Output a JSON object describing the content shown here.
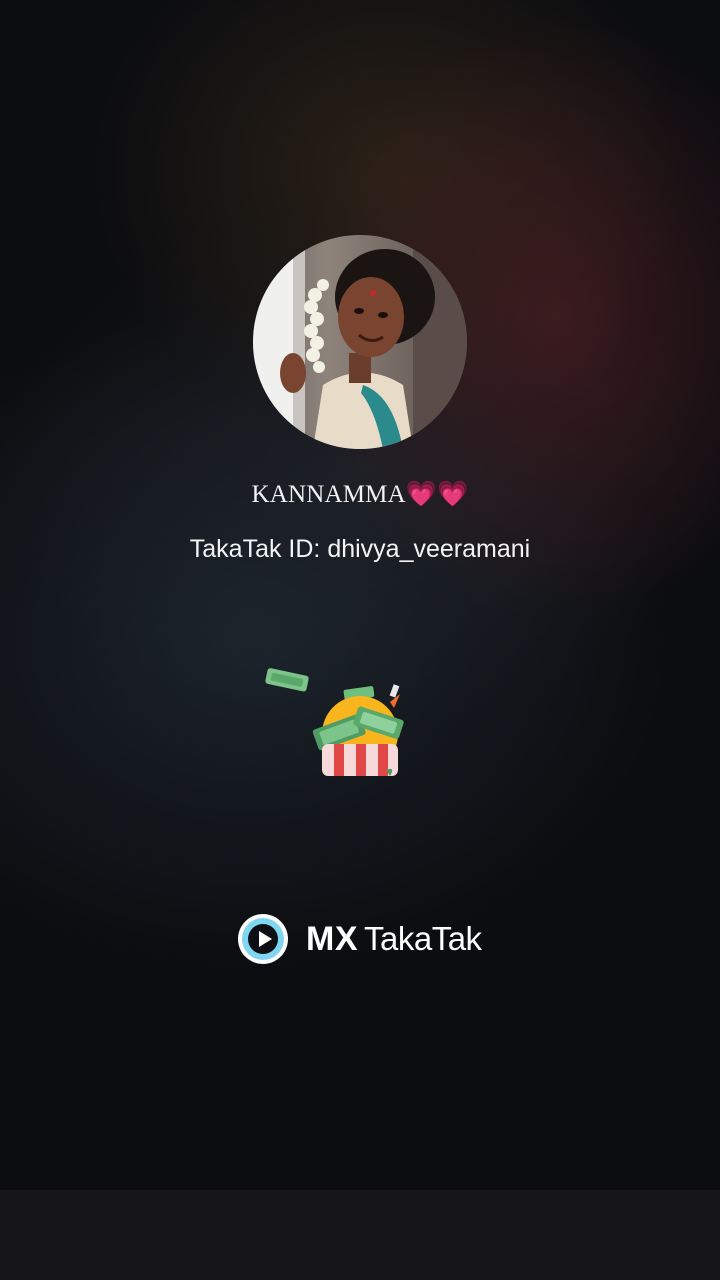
{
  "profile": {
    "display_name": "KANNAMMA💗💗",
    "takatak_id_label": "TakaTak ID: dhivya_veeramani"
  },
  "brand": {
    "mx_text": "MX",
    "takatak_text": "TakaTak",
    "accent_color": "#7fd6ee"
  },
  "icons": {
    "avatar": "profile-photo",
    "gift": "money-gift-icon",
    "logo": "play-icon"
  }
}
